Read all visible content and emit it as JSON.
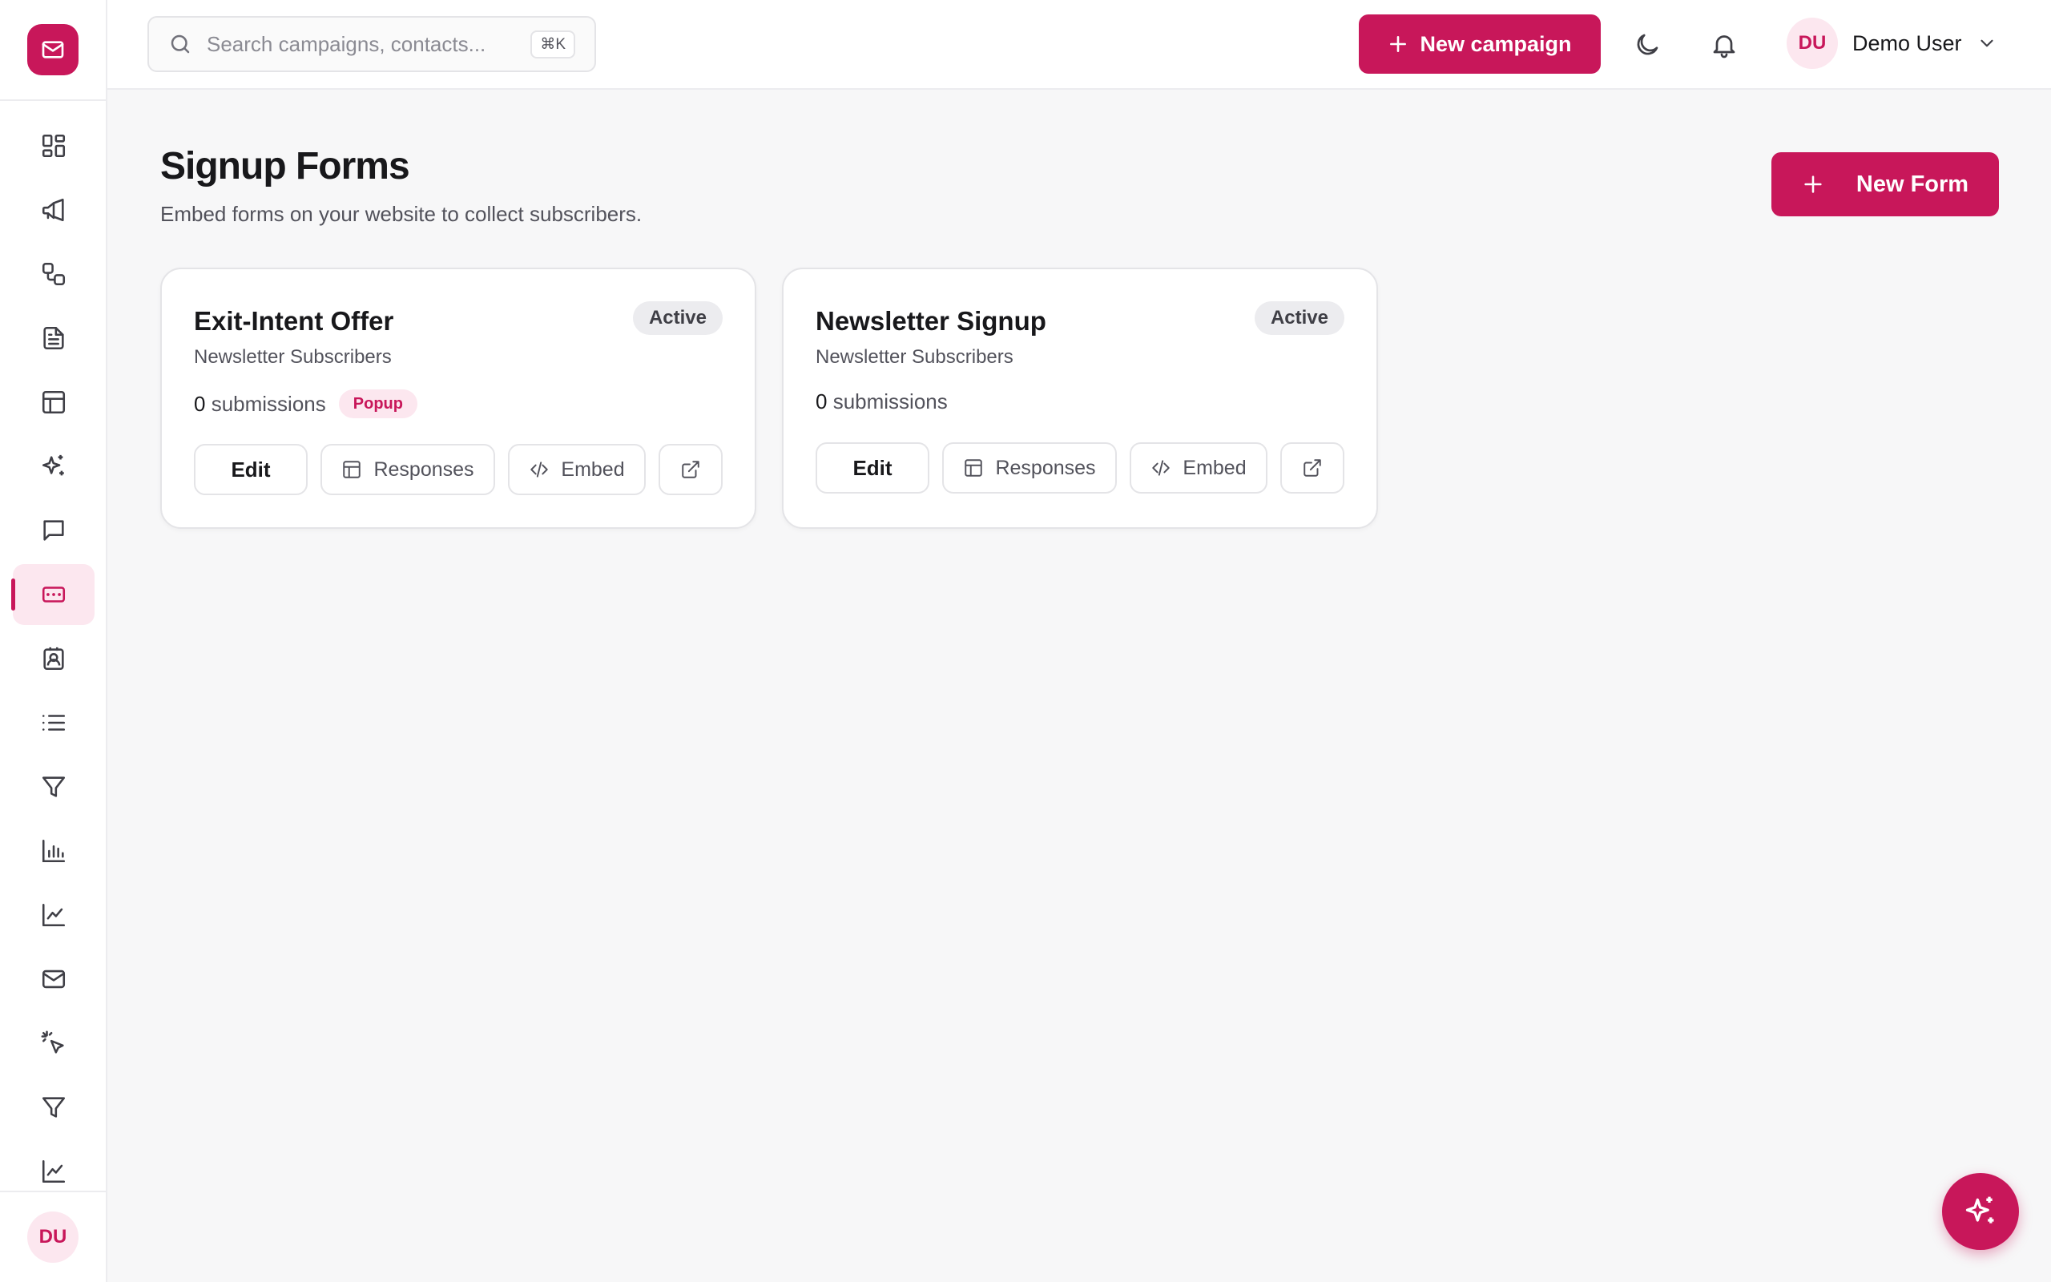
{
  "colors": {
    "accent": "#c8175a",
    "accent_soft": "#fce7ef",
    "background": "#f7f7f8"
  },
  "sidebar": {
    "logo_icon": "mail-icon",
    "items": [
      {
        "id": "dashboard",
        "icon": "grid-icon"
      },
      {
        "id": "campaigns",
        "icon": "megaphone-icon"
      },
      {
        "id": "automations",
        "icon": "workflow-icon"
      },
      {
        "id": "templates",
        "icon": "document-icon"
      },
      {
        "id": "layouts",
        "icon": "layout-icon"
      },
      {
        "id": "ai",
        "icon": "sparkles-icon"
      },
      {
        "id": "messages",
        "icon": "chat-icon"
      },
      {
        "id": "forms",
        "icon": "form-icon",
        "active": true
      },
      {
        "id": "contacts",
        "icon": "contact-card-icon"
      },
      {
        "id": "lists",
        "icon": "list-icon"
      },
      {
        "id": "segments",
        "icon": "filter-icon"
      },
      {
        "id": "reports",
        "icon": "bar-chart-icon"
      },
      {
        "id": "analytics",
        "icon": "line-chart-icon"
      },
      {
        "id": "inbox",
        "icon": "envelope-icon"
      },
      {
        "id": "tracking",
        "icon": "click-icon"
      },
      {
        "id": "funnels",
        "icon": "funnel-icon"
      },
      {
        "id": "trends",
        "icon": "trend-chart-icon"
      }
    ],
    "user_initials": "DU"
  },
  "topbar": {
    "search_placeholder": "Search campaigns, contacts...",
    "search_shortcut": "⌘K",
    "new_campaign_label": "New campaign",
    "user_initials": "DU",
    "user_name": "Demo User"
  },
  "page": {
    "title": "Signup Forms",
    "subtitle": "Embed forms on your website to collect subscribers.",
    "new_form_label": "New Form"
  },
  "forms": [
    {
      "name": "Exit-Intent Offer",
      "list": "Newsletter Subscribers",
      "status": "Active",
      "count": "0",
      "count_label": "submissions",
      "type": "Popup",
      "edit_label": "Edit",
      "responses_label": "Responses",
      "embed_label": "Embed"
    },
    {
      "name": "Newsletter Signup",
      "list": "Newsletter Subscribers",
      "status": "Active",
      "count": "0",
      "count_label": "submissions",
      "type": "",
      "edit_label": "Edit",
      "responses_label": "Responses",
      "embed_label": "Embed"
    }
  ],
  "fab_icon": "sparkles-icon"
}
